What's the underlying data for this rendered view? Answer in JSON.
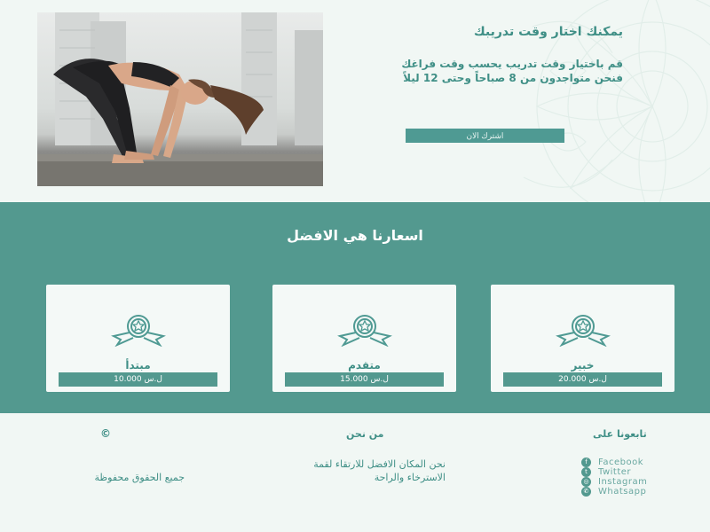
{
  "hero": {
    "title": "يمكنك اختار وقت تدريبك",
    "description": "قم باختيار وقت تدريب يحسب وقت فراغك فنحن متواجدون من 8 صباحاً وحتى 12 ليلاً",
    "button_label": "اشترك الان"
  },
  "prices": {
    "title": "اسعارنا هي الافضل",
    "cards": [
      {
        "name": "خبير",
        "price": "ل.س 20.000",
        "icon": "award-icon"
      },
      {
        "name": "متقدم",
        "price": "ل.س 15.000",
        "icon": "award-icon"
      },
      {
        "name": "مبتدأ",
        "price": "ل.س 10.000",
        "icon": "award-icon"
      }
    ]
  },
  "footer": {
    "follow_title": "تابعونا على",
    "social": [
      {
        "label": "Facebook",
        "icon": "facebook-icon"
      },
      {
        "label": "Twitter",
        "icon": "twitter-icon"
      },
      {
        "label": "Instagram",
        "icon": "instagram-icon"
      },
      {
        "label": "Whatsapp",
        "icon": "whatsapp-icon"
      }
    ],
    "about_title": "من نحن",
    "about_text": "نحن المكان الافضل للارتقاء لقمة الاسترخاء والراحة",
    "copyright_symbol": "©",
    "rights_text": "جميع الحقوق محفوظة"
  },
  "colors": {
    "accent": "#53998f",
    "background": "#f1f7f4",
    "card": "#f4f9f7"
  }
}
